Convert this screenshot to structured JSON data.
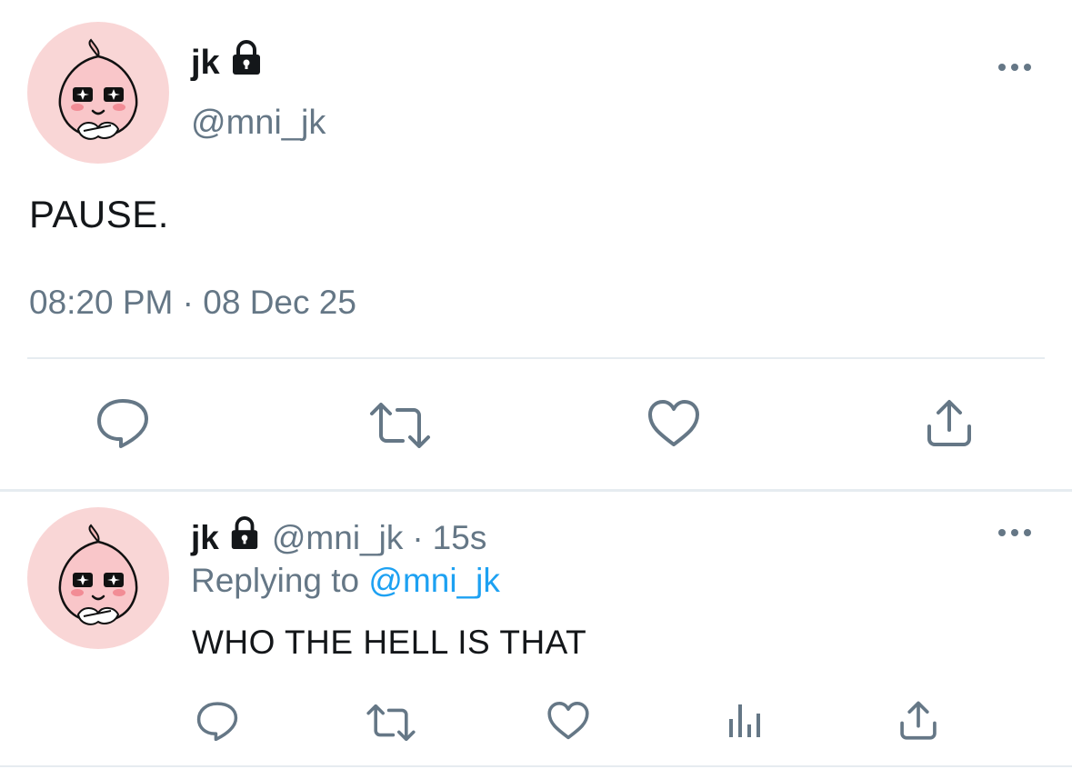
{
  "main_tweet": {
    "display_name": "jk",
    "handle": "@mni_jk",
    "text": "PAUSE.",
    "time": "08:20 PM",
    "separator": "·",
    "date": "08 Dec 25"
  },
  "reply": {
    "display_name": "jk",
    "handle": "@mni_jk",
    "dot": "·",
    "age": "15s",
    "replying_prefix": "Replying to",
    "replying_to": "@mni_jk",
    "text": "WHO THE HELL IS THAT"
  },
  "icons": {
    "lock": "lock-icon",
    "more": "more-horizontal-icon",
    "reply": "reply-icon",
    "retweet": "retweet-icon",
    "like": "heart-icon",
    "share": "share-icon",
    "analytics": "analytics-icon"
  },
  "colors": {
    "text_primary": "#14171a",
    "text_secondary": "#657786",
    "link": "#1da1f2",
    "avatar_bg": "#f9d6d6",
    "divider": "#e6ecf0"
  }
}
